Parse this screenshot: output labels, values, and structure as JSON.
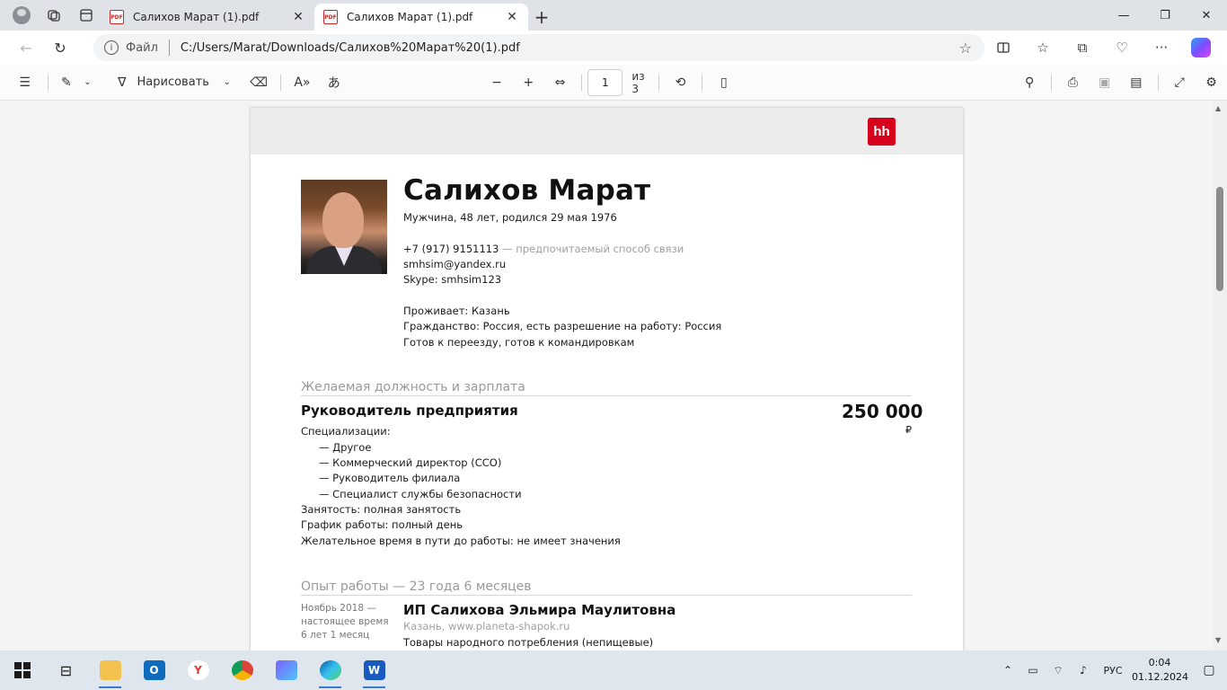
{
  "browser": {
    "tabs": [
      {
        "title": "Салихов Марат (1).pdf",
        "active": false
      },
      {
        "title": "Салихов Марат (1).pdf",
        "active": true
      }
    ],
    "new_tab": "+",
    "window": {
      "minimize": "—",
      "restore": "❐",
      "close": "✕"
    },
    "address": {
      "scheme_label": "Файл",
      "url": "C:/Users/Marat/Downloads/Салихов%20Марат%20(1).pdf"
    }
  },
  "pdf_toolbar": {
    "draw_label": "Нарисовать",
    "page_value": "1",
    "page_total": "из 3"
  },
  "resume": {
    "logo": "hh",
    "name": "Салихов Марат",
    "personal": "Мужчина, 48 лет, родился 29 мая 1976",
    "phone": "+7 (917) 9151113",
    "phone_note": "— предпочитаемый способ связи",
    "email": "smhsim@yandex.ru",
    "skype": "Skype: smhsim123",
    "lives": "Проживает: Казань",
    "citizenship": "Гражданство: Россия, есть разрешение на работу: Россия",
    "relocation": "Готов к переезду, готов к командировкам",
    "desired_section": "Желаемая должность и зарплата",
    "position": "Руководитель предприятия",
    "salary": "250 000",
    "currency": "₽",
    "specializations_label": "Специализации:",
    "specializations": [
      "—  Другое",
      "—  Коммерческий директор (CCO)",
      "—  Руководитель филиала",
      "—  Специалист службы безопасности"
    ],
    "employment": "Занятость: полная занятость",
    "schedule": "График работы: полный день",
    "commute": "Желательное время в пути до работы: не имеет значения",
    "experience_section": "Опыт работы — 23 года 6 месяцев",
    "job": {
      "period_start": "Ноябрь 2018 —",
      "period_end": "настоящее время",
      "duration": "6 лет 1 месяц",
      "company": "ИП Салихова Эльмира Маулитовна",
      "location": "Казань, www.planeta-shapok.ru",
      "industry": "Товары народного потребления (непищевые)"
    }
  },
  "taskbar": {
    "lang": "РУС",
    "time": "0:04",
    "date": "01.12.2024"
  },
  "colors": {
    "hh_red": "#d6001c",
    "tab_active": "#ffffff",
    "titlebar": "#dfe3e8",
    "taskbar": "#dfe6ee"
  }
}
